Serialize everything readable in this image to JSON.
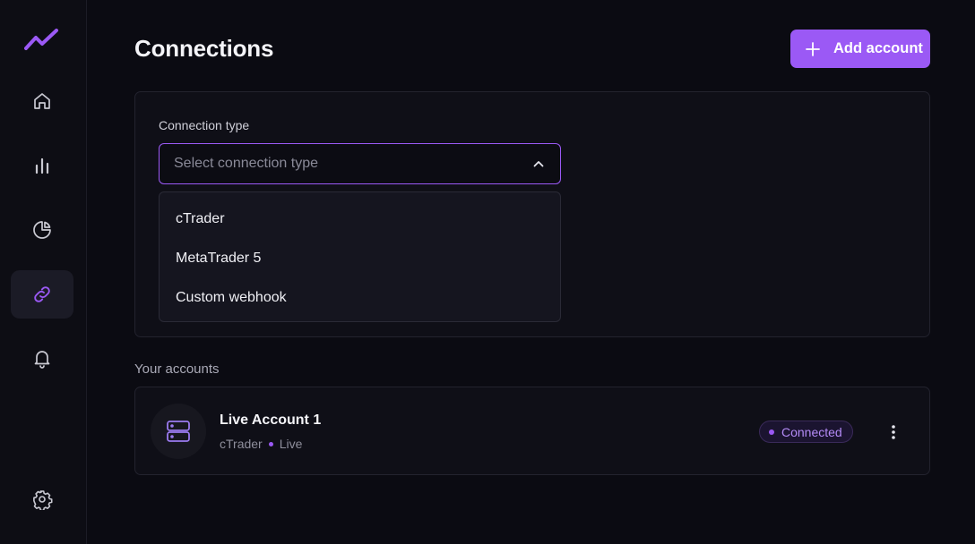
{
  "page": {
    "title": "Connections"
  },
  "header": {
    "add_button_label": "Add account"
  },
  "sidebar": {
    "items": [
      {
        "name": "home",
        "icon": "home-icon",
        "active": false
      },
      {
        "name": "analytics",
        "icon": "bar-chart-icon",
        "active": false
      },
      {
        "name": "reports",
        "icon": "pie-chart-icon",
        "active": false
      },
      {
        "name": "connections",
        "icon": "link-icon",
        "active": true
      },
      {
        "name": "notifications",
        "icon": "bell-icon",
        "active": false
      },
      {
        "name": "settings",
        "icon": "gear-icon",
        "active": false
      }
    ]
  },
  "connection_form": {
    "label": "Connection type",
    "select_placeholder": "Select connection type",
    "options": [
      "cTrader",
      "MetaTrader 5",
      "Custom webhook"
    ]
  },
  "accounts_section": {
    "label": "Your accounts",
    "accounts": [
      {
        "name": "Live Account 1",
        "platform": "cTrader",
        "mode": "Live",
        "status": "Connected"
      }
    ]
  },
  "colors": {
    "accent": "#9b59f5",
    "background": "#0b0b12",
    "panel": "#0f0f17",
    "text": "#ececf1",
    "muted": "#8e8e9b"
  }
}
